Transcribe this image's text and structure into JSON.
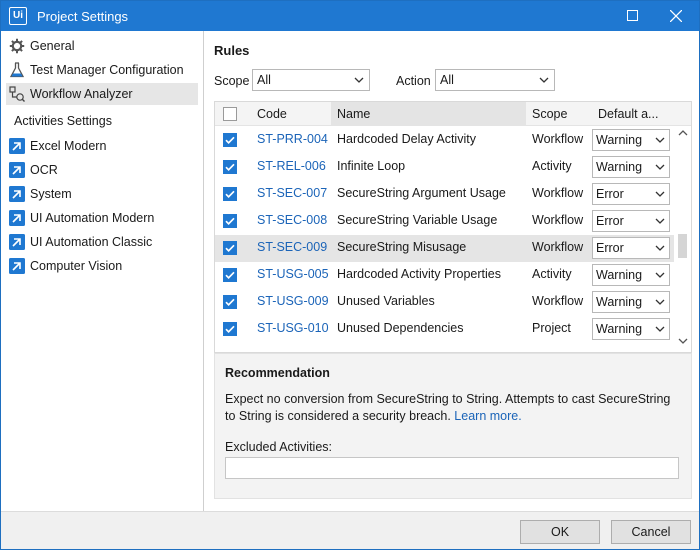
{
  "window": {
    "logo": "Ui",
    "title": "Project Settings"
  },
  "sidebar": {
    "items": [
      {
        "label": "General",
        "icon": "gear-icon"
      },
      {
        "label": "Test Manager Configuration",
        "icon": "flask-icon"
      },
      {
        "label": "Workflow Analyzer",
        "icon": "workflow-analyzer-icon",
        "selected": true
      }
    ],
    "section_label": "Activities Settings",
    "activity_items": [
      {
        "label": "Excel Modern",
        "icon": "package-icon"
      },
      {
        "label": "OCR",
        "icon": "package-icon"
      },
      {
        "label": "System",
        "icon": "package-icon"
      },
      {
        "label": "UI Automation Modern",
        "icon": "package-icon"
      },
      {
        "label": "UI Automation Classic",
        "icon": "package-icon"
      },
      {
        "label": "Computer Vision",
        "icon": "package-icon"
      }
    ]
  },
  "rules": {
    "title": "Rules",
    "scope_label": "Scope",
    "scope_value": "All",
    "action_label": "Action",
    "action_value": "All",
    "columns": {
      "code": "Code",
      "name": "Name",
      "scope": "Scope",
      "default_action": "Default a..."
    },
    "rows": [
      {
        "checked": true,
        "code": "ST-PRR-004",
        "name": "Hardcoded Delay Activity",
        "scope": "Workflow",
        "action": "Warning"
      },
      {
        "checked": true,
        "code": "ST-REL-006",
        "name": "Infinite Loop",
        "scope": "Activity",
        "action": "Warning"
      },
      {
        "checked": true,
        "code": "ST-SEC-007",
        "name": "SecureString Argument Usage",
        "scope": "Workflow",
        "action": "Error"
      },
      {
        "checked": true,
        "code": "ST-SEC-008",
        "name": "SecureString Variable Usage",
        "scope": "Workflow",
        "action": "Error"
      },
      {
        "checked": true,
        "code": "ST-SEC-009",
        "name": "SecureString Misusage",
        "scope": "Workflow",
        "action": "Error",
        "selected": true
      },
      {
        "checked": true,
        "code": "ST-USG-005",
        "name": "Hardcoded Activity Properties",
        "scope": "Activity",
        "action": "Warning"
      },
      {
        "checked": true,
        "code": "ST-USG-009",
        "name": "Unused Variables",
        "scope": "Workflow",
        "action": "Warning"
      },
      {
        "checked": true,
        "code": "ST-USG-010",
        "name": "Unused Dependencies",
        "scope": "Project",
        "action": "Warning"
      }
    ]
  },
  "recommendation": {
    "title": "Recommendation",
    "text": "Expect no conversion from SecureString to String. Attempts to cast SecureString to String is considered a security breach.",
    "link": "Learn more.",
    "excluded_label": "Excluded Activities:",
    "excluded_value": ""
  },
  "footer": {
    "ok": "OK",
    "cancel": "Cancel"
  },
  "colors": {
    "titlebar": "#1f78d1",
    "link": "#1b64b8",
    "checkbox": "#1f78d1"
  }
}
